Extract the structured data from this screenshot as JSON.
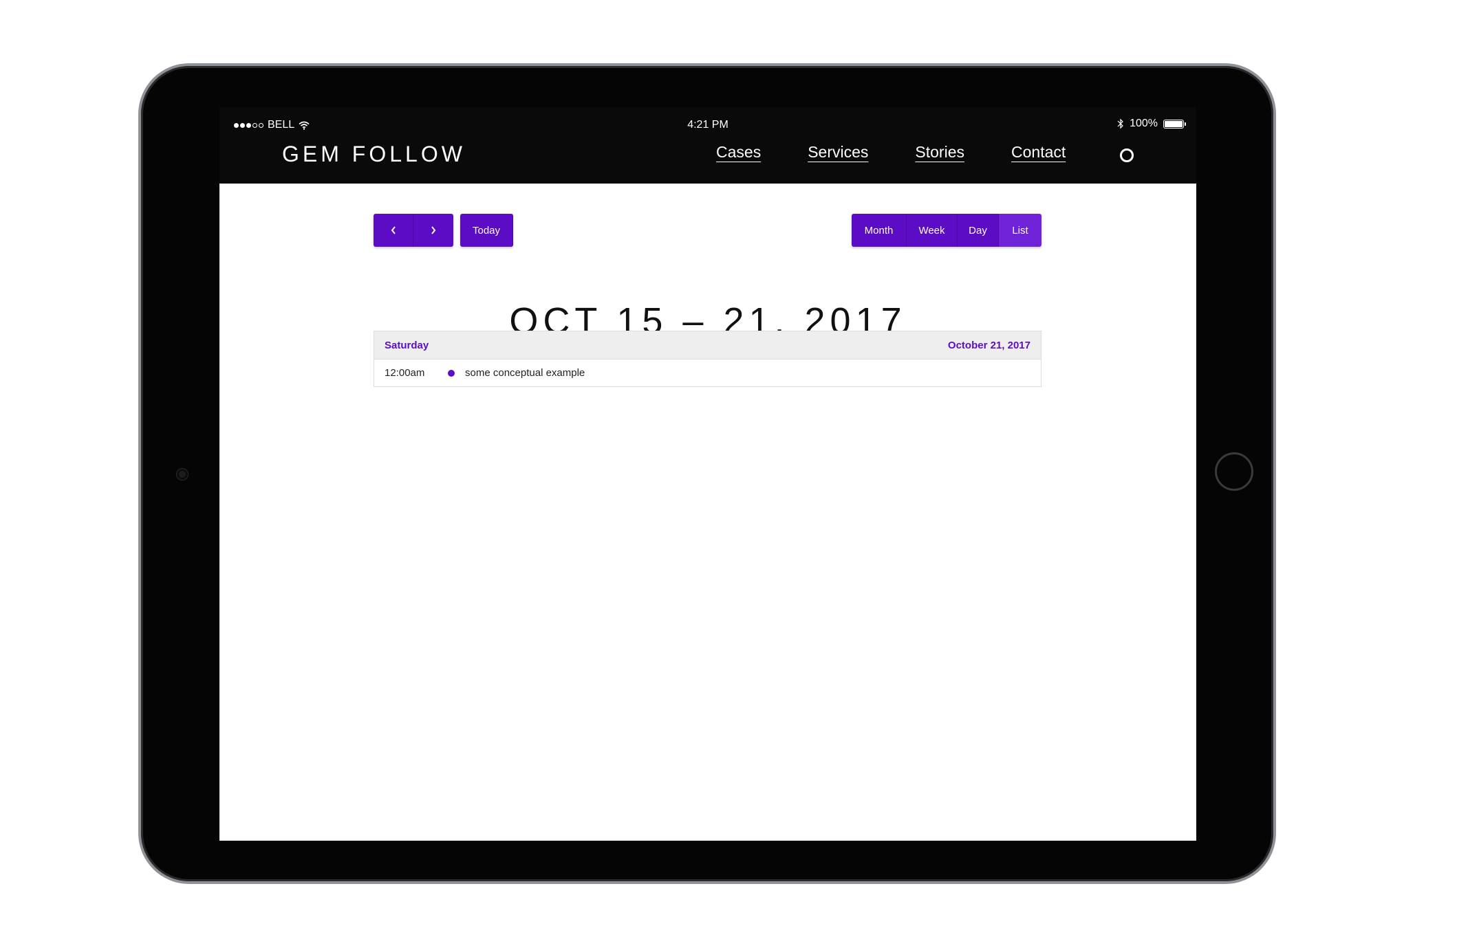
{
  "status_bar": {
    "carrier": "BELL",
    "time": "4:21 PM",
    "battery_percent": "100%",
    "icons": [
      "signal-dots-icon",
      "wifi-icon",
      "bluetooth-icon",
      "battery-icon"
    ]
  },
  "header": {
    "brand": "GEM FOLLOW",
    "nav": [
      "Cases",
      "Services",
      "Stories",
      "Contact"
    ],
    "search_icon": "search-icon"
  },
  "calendar": {
    "prev_label": "‹",
    "next_label": "›",
    "today_label": "Today",
    "views": [
      "Month",
      "Week",
      "Day",
      "List"
    ],
    "active_view": "List",
    "range_title": "OCT 15 – 21, 2017",
    "day_heading": {
      "weekday": "Saturday",
      "date": "October 21, 2017"
    },
    "events": [
      {
        "time": "12:00am",
        "title": "some conceptual example"
      }
    ]
  },
  "colors": {
    "accent": "#5c0cc4",
    "header_bg": "#0a0a0a",
    "heading_bg": "#eeeeee"
  }
}
